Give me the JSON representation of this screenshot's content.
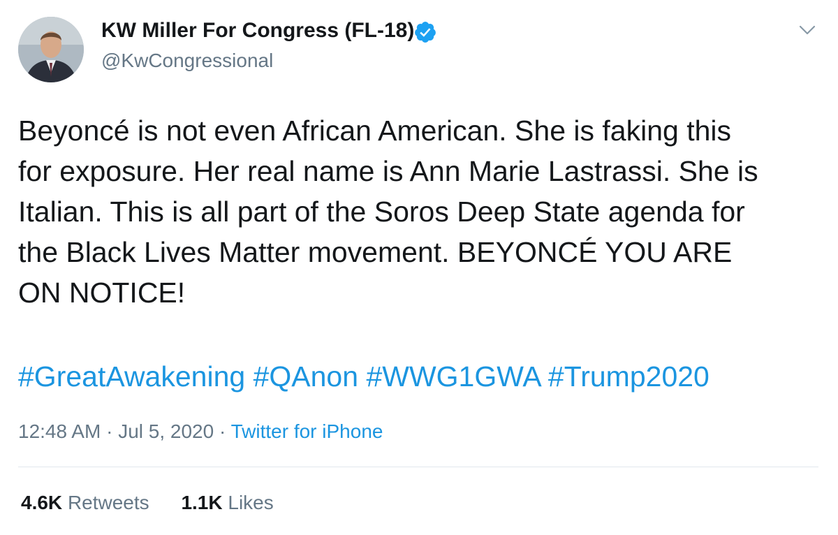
{
  "author": {
    "display_name": "KW Miller For Congress (FL-18)",
    "handle": "@KwCongressional",
    "verified": true
  },
  "tweet": {
    "text_lines": [
      "Beyoncé is not even African American. She is faking this",
      "for exposure. Her real name is Ann Marie Lastrassi. She is",
      "Italian. This is all part of the Soros Deep State agenda for",
      "the Black Lives Matter movement. BEYONCÉ YOU ARE",
      "ON NOTICE!"
    ],
    "hashtags": [
      "#GreatAwakening",
      "#QAnon",
      "#WWG1GWA",
      "#Trump2020"
    ],
    "time": "12:48 AM",
    "date": "Jul 5, 2020",
    "separator": "·",
    "source": "Twitter for iPhone"
  },
  "stats": {
    "retweets_count": "4.6K",
    "retweets_label": "Retweets",
    "likes_count": "1.1K",
    "likes_label": "Likes"
  },
  "colors": {
    "link": "#1b95e0",
    "secondary_text": "#657786",
    "primary_text": "#14171a",
    "verified_badge": "#1da1f2",
    "divider": "#e1e8ed"
  },
  "icons": {
    "verified": "verified-badge-icon",
    "menu": "chevron-down-icon"
  }
}
